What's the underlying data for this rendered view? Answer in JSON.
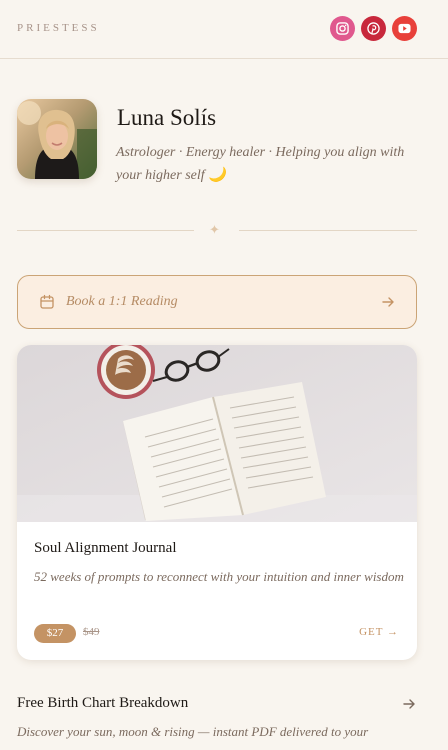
{
  "header": {
    "brand": "PRIESTESS",
    "socials": [
      {
        "icon": "instagram-icon",
        "color": "#e0588e"
      },
      {
        "icon": "pinterest-icon",
        "color": "#c8283c"
      },
      {
        "icon": "youtube-icon",
        "color": "#e8403a"
      }
    ]
  },
  "profile": {
    "name": "Luna Solís",
    "bio": "Astrologer · Energy healer · Helping you align with your higher self 🌙"
  },
  "divider": {
    "glyph": "✦"
  },
  "book": {
    "label": "Book a 1:1 Reading",
    "icon": "calendar-icon"
  },
  "product": {
    "title": "Soul Alignment Journal",
    "description": "52 weeks of prompts to reconnect with your intuition and inner wisdom",
    "price": "$27",
    "old_price": "$49",
    "cta": "GET →"
  },
  "link2": {
    "title": "Free Birth Chart Breakdown",
    "description": "Discover your sun, moon & rising — instant PDF delivered to your inbox"
  },
  "colors": {
    "accent": "#c49364",
    "background": "#f9f5ef",
    "button_fill": "#fbeee1"
  }
}
